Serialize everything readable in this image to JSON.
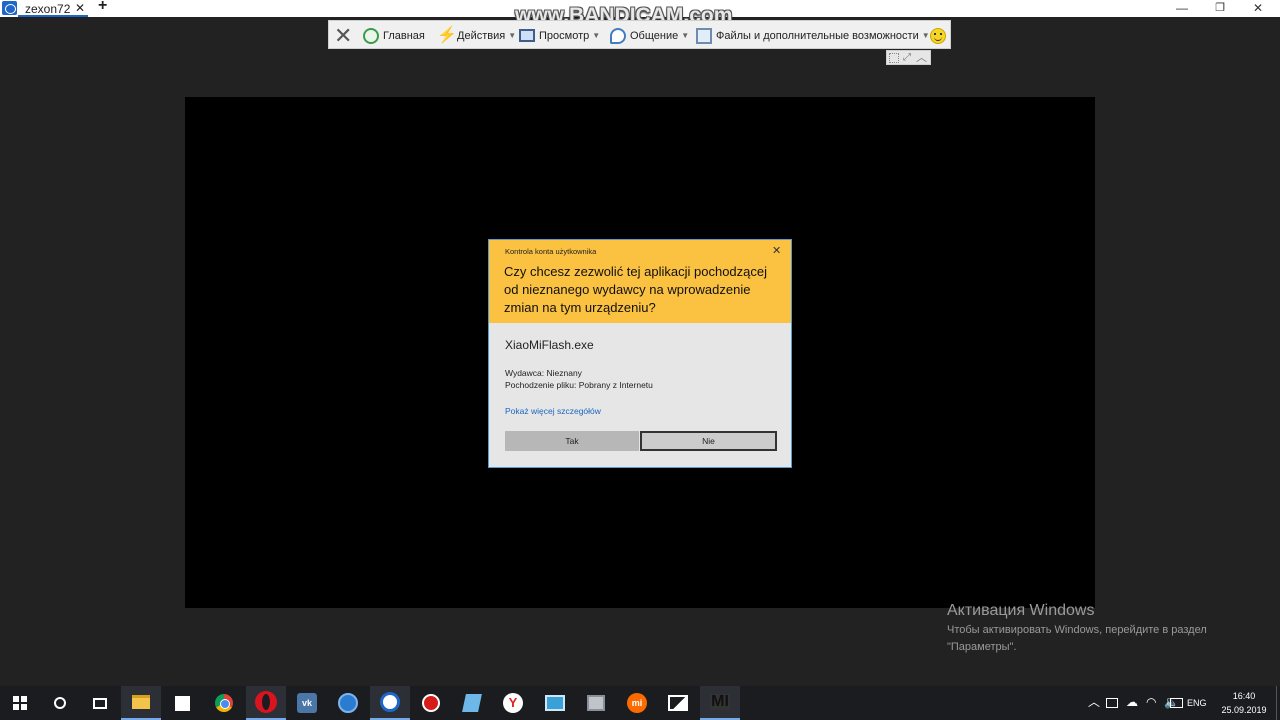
{
  "tabbar": {
    "session_label": "zexon72",
    "close_glyph": "✕",
    "add_glyph": "+",
    "minimize_glyph": "—",
    "restore_glyph": "❐",
    "close_window_glyph": "✕"
  },
  "watermark": {
    "text": "www.BANDICAM.com"
  },
  "toolbar": {
    "close_glyph": "✕",
    "home_label": "Главная",
    "actions_label": "Действия",
    "view_label": "Просмотр",
    "communication_label": "Общение",
    "files_label": "Файлы и дополнительные возможности",
    "dropdown_glyph": "▼"
  },
  "toolbar_sub": {
    "expand_glyph": "⤢",
    "collapse_glyph": "︿"
  },
  "uac": {
    "caption": "Kontrola konta użytkownika",
    "close_glyph": "✕",
    "question": "Czy chcesz zezwolić tej aplikacji pochodzącej od nieznanego wydawcy na wprowadzenie zmian na tym urządzeniu?",
    "app_name": "XiaoMiFlash.exe",
    "publisher": "Wydawca: Nieznany",
    "origin": "Pochodzenie pliku: Pobrany z Internetu",
    "details_link": "Pokaż więcej szczegółów",
    "yes_label": "Tak",
    "no_label": "Nie",
    "header_color": "#fbc141"
  },
  "activation": {
    "title": "Активация Windows",
    "text_line1": "Чтобы активировать Windows, перейдите в раздел",
    "text_line2": "\"Параметры\"."
  },
  "taskbar": {
    "vk_label": "vk",
    "yandex_label": "Y",
    "mi_label": "mi",
    "mi_dark_label": "MI",
    "tray_up_glyph": "︿",
    "tray_cloud_glyph": "☁",
    "tray_wifi_glyph": "◠",
    "tray_volume_glyph": "🔈",
    "language": "ENG",
    "time": "16:40",
    "date": "25.09.2019"
  }
}
